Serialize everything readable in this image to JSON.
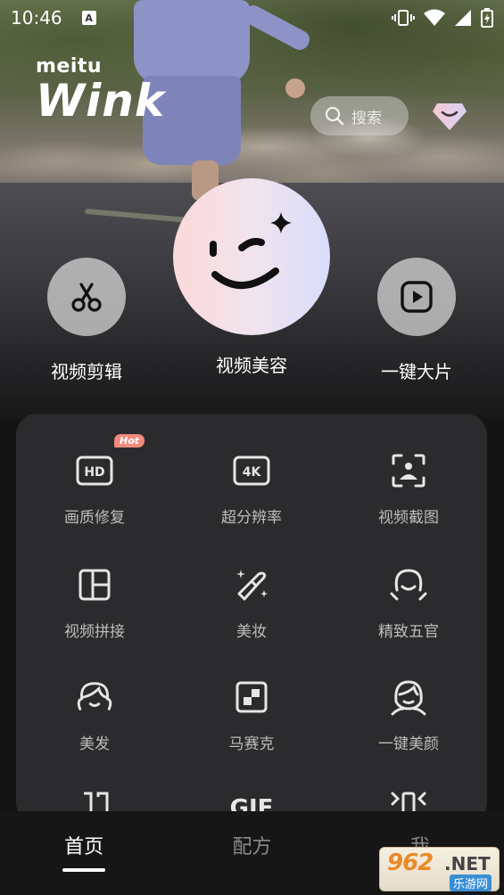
{
  "status_bar": {
    "time": "10:46",
    "notification_badge": "A"
  },
  "brand": {
    "top": "meitu",
    "name": "Wink"
  },
  "search": {
    "placeholder": "搜索"
  },
  "actions": [
    {
      "label": "视频剪辑",
      "icon": "scissors-icon"
    },
    {
      "label": "视频美容",
      "icon": "wink-face-icon"
    },
    {
      "label": "一键大片",
      "icon": "play-icon"
    }
  ],
  "tools": [
    {
      "label": "画质修复",
      "icon": "hd-icon",
      "badge": "Hot"
    },
    {
      "label": "超分辨率",
      "icon": "4k-icon"
    },
    {
      "label": "视频截图",
      "icon": "screenshot-icon"
    },
    {
      "label": "视频拼接",
      "icon": "collage-icon"
    },
    {
      "label": "美妆",
      "icon": "makeup-icon"
    },
    {
      "label": "精致五官",
      "icon": "face-features-icon"
    },
    {
      "label": "美发",
      "icon": "hair-icon"
    },
    {
      "label": "马赛克",
      "icon": "mosaic-icon"
    },
    {
      "label": "一键美颜",
      "icon": "beauty-icon"
    }
  ],
  "partial_tools_row": {
    "gif_label": "GIF"
  },
  "bottom_nav": [
    {
      "label": "首页",
      "active": true
    },
    {
      "label": "配方",
      "active": false
    },
    {
      "label": "我",
      "active": false
    }
  ],
  "watermark": {
    "number": "962",
    "suffix": ".NET",
    "site": "乐游网"
  },
  "colors": {
    "panel": "#2b2b2d",
    "hot_badge": "#f08a7a",
    "center_gradient_start": "#fbd9d9",
    "center_gradient_end": "#d9dcfb"
  }
}
